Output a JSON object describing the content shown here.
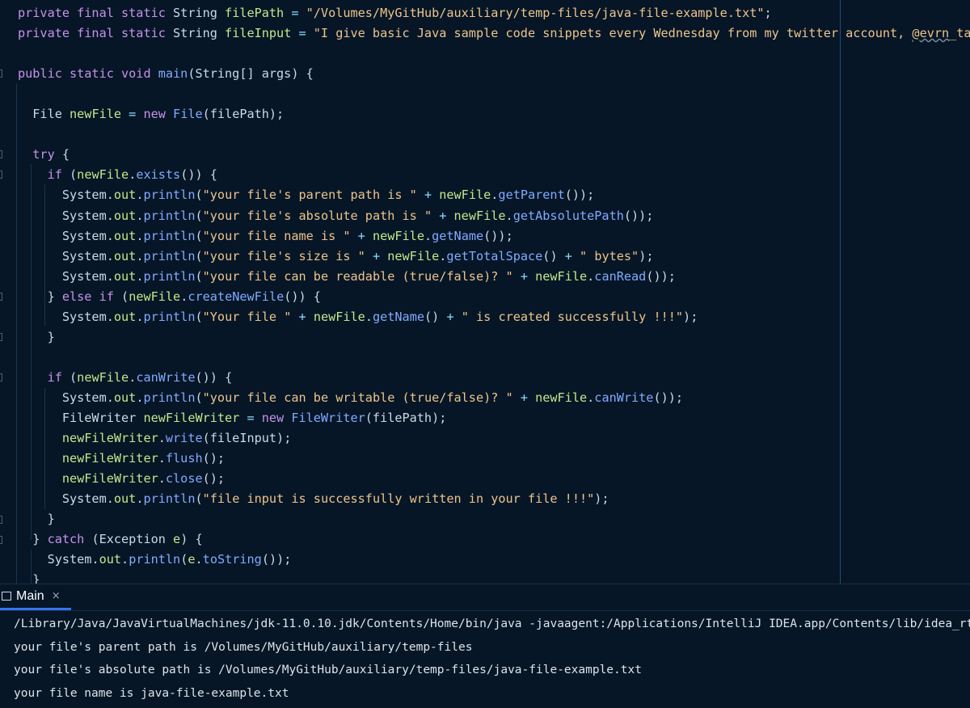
{
  "editor": {
    "lines": [
      [
        {
          "c": "kw",
          "t": "private final static "
        },
        {
          "c": "pl",
          "t": "String "
        },
        {
          "c": "id",
          "t": "filePath"
        },
        {
          "c": "op",
          "t": " = "
        },
        {
          "c": "st",
          "t": "\"/Volumes/MyGitHub/auxiliary/temp-files/java-file-example.txt\""
        },
        {
          "c": "pl",
          "t": ";"
        }
      ],
      [
        {
          "c": "kw",
          "t": "private final static "
        },
        {
          "c": "pl",
          "t": "String "
        },
        {
          "c": "id",
          "t": "fileInput"
        },
        {
          "c": "op",
          "t": " = "
        },
        {
          "c": "st",
          "t": "\"I give basic Java sample code snippets every Wednesday from my twitter account, "
        },
        {
          "c": "st wavy",
          "t": "@evrn"
        },
        {
          "c": "st",
          "t": "_tan !!!\""
        },
        {
          "c": "pl",
          "t": ";"
        }
      ],
      [],
      [
        {
          "c": "kw",
          "t": "public static void "
        },
        {
          "c": "fn",
          "t": "main"
        },
        {
          "c": "pl",
          "t": "(String[] args) {"
        }
      ],
      [],
      [
        {
          "c": "pl",
          "t": "  File "
        },
        {
          "c": "id",
          "t": "newFile"
        },
        {
          "c": "op",
          "t": " = "
        },
        {
          "c": "kw",
          "t": "new "
        },
        {
          "c": "fn",
          "t": "File"
        },
        {
          "c": "pl",
          "t": "(filePath);"
        }
      ],
      [],
      [
        {
          "c": "kw",
          "t": "  try "
        },
        {
          "c": "pl",
          "t": "{"
        }
      ],
      [
        {
          "c": "kw",
          "t": "    if "
        },
        {
          "c": "pl",
          "t": "("
        },
        {
          "c": "id",
          "t": "newFile"
        },
        {
          "c": "pl",
          "t": "."
        },
        {
          "c": "fn",
          "t": "exists"
        },
        {
          "c": "pl",
          "t": "()) {"
        }
      ],
      [
        {
          "c": "pl",
          "t": "      System."
        },
        {
          "c": "id",
          "t": "out"
        },
        {
          "c": "pl",
          "t": "."
        },
        {
          "c": "fn",
          "t": "println"
        },
        {
          "c": "pl",
          "t": "("
        },
        {
          "c": "st",
          "t": "\"your file's parent path is \""
        },
        {
          "c": "op",
          "t": " + "
        },
        {
          "c": "id",
          "t": "newFile"
        },
        {
          "c": "pl",
          "t": "."
        },
        {
          "c": "fn",
          "t": "getParent"
        },
        {
          "c": "pl",
          "t": "());"
        }
      ],
      [
        {
          "c": "pl",
          "t": "      System."
        },
        {
          "c": "id",
          "t": "out"
        },
        {
          "c": "pl",
          "t": "."
        },
        {
          "c": "fn",
          "t": "println"
        },
        {
          "c": "pl",
          "t": "("
        },
        {
          "c": "st",
          "t": "\"your file's absolute path is \""
        },
        {
          "c": "op",
          "t": " + "
        },
        {
          "c": "id",
          "t": "newFile"
        },
        {
          "c": "pl",
          "t": "."
        },
        {
          "c": "fn",
          "t": "getAbsolutePath"
        },
        {
          "c": "pl",
          "t": "());"
        }
      ],
      [
        {
          "c": "pl",
          "t": "      System."
        },
        {
          "c": "id",
          "t": "out"
        },
        {
          "c": "pl",
          "t": "."
        },
        {
          "c": "fn",
          "t": "println"
        },
        {
          "c": "pl",
          "t": "("
        },
        {
          "c": "st",
          "t": "\"your file name is \""
        },
        {
          "c": "op",
          "t": " + "
        },
        {
          "c": "id",
          "t": "newFile"
        },
        {
          "c": "pl",
          "t": "."
        },
        {
          "c": "fn",
          "t": "getName"
        },
        {
          "c": "pl",
          "t": "());"
        }
      ],
      [
        {
          "c": "pl",
          "t": "      System."
        },
        {
          "c": "id",
          "t": "out"
        },
        {
          "c": "pl",
          "t": "."
        },
        {
          "c": "fn",
          "t": "println"
        },
        {
          "c": "pl",
          "t": "("
        },
        {
          "c": "st",
          "t": "\"your file's size is \""
        },
        {
          "c": "op",
          "t": " + "
        },
        {
          "c": "id",
          "t": "newFile"
        },
        {
          "c": "pl",
          "t": "."
        },
        {
          "c": "fn",
          "t": "getTotalSpace"
        },
        {
          "c": "pl",
          "t": "()"
        },
        {
          "c": "op",
          "t": " + "
        },
        {
          "c": "st",
          "t": "\" bytes\""
        },
        {
          "c": "pl",
          "t": ");"
        }
      ],
      [
        {
          "c": "pl",
          "t": "      System."
        },
        {
          "c": "id",
          "t": "out"
        },
        {
          "c": "pl",
          "t": "."
        },
        {
          "c": "fn",
          "t": "println"
        },
        {
          "c": "pl",
          "t": "("
        },
        {
          "c": "st",
          "t": "\"your file can be readable (true/false)? \""
        },
        {
          "c": "op",
          "t": " + "
        },
        {
          "c": "id",
          "t": "newFile"
        },
        {
          "c": "pl",
          "t": "."
        },
        {
          "c": "fn",
          "t": "canRead"
        },
        {
          "c": "pl",
          "t": "());"
        }
      ],
      [
        {
          "c": "pl",
          "t": "    } "
        },
        {
          "c": "kw",
          "t": "else if "
        },
        {
          "c": "pl",
          "t": "("
        },
        {
          "c": "id",
          "t": "newFile"
        },
        {
          "c": "pl",
          "t": "."
        },
        {
          "c": "fn",
          "t": "createNewFile"
        },
        {
          "c": "pl",
          "t": "()) {"
        }
      ],
      [
        {
          "c": "pl",
          "t": "      System."
        },
        {
          "c": "id",
          "t": "out"
        },
        {
          "c": "pl",
          "t": "."
        },
        {
          "c": "fn",
          "t": "println"
        },
        {
          "c": "pl",
          "t": "("
        },
        {
          "c": "st",
          "t": "\"Your file \""
        },
        {
          "c": "op",
          "t": " + "
        },
        {
          "c": "id",
          "t": "newFile"
        },
        {
          "c": "pl",
          "t": "."
        },
        {
          "c": "fn",
          "t": "getName"
        },
        {
          "c": "pl",
          "t": "()"
        },
        {
          "c": "op",
          "t": " + "
        },
        {
          "c": "st",
          "t": "\" is created successfully !!!\""
        },
        {
          "c": "pl",
          "t": ");"
        }
      ],
      [
        {
          "c": "pl",
          "t": "    }"
        }
      ],
      [],
      [
        {
          "c": "kw",
          "t": "    if "
        },
        {
          "c": "pl",
          "t": "("
        },
        {
          "c": "id",
          "t": "newFile"
        },
        {
          "c": "pl",
          "t": "."
        },
        {
          "c": "fn",
          "t": "canWrite"
        },
        {
          "c": "pl",
          "t": "()) {"
        }
      ],
      [
        {
          "c": "pl",
          "t": "      System."
        },
        {
          "c": "id",
          "t": "out"
        },
        {
          "c": "pl",
          "t": "."
        },
        {
          "c": "fn",
          "t": "println"
        },
        {
          "c": "pl",
          "t": "("
        },
        {
          "c": "st",
          "t": "\"your file can be writable (true/false)? \""
        },
        {
          "c": "op",
          "t": " + "
        },
        {
          "c": "id",
          "t": "newFile"
        },
        {
          "c": "pl",
          "t": "."
        },
        {
          "c": "fn",
          "t": "canWrite"
        },
        {
          "c": "pl",
          "t": "());"
        }
      ],
      [
        {
          "c": "pl",
          "t": "      FileWriter "
        },
        {
          "c": "id",
          "t": "newFileWriter"
        },
        {
          "c": "op",
          "t": " = "
        },
        {
          "c": "kw",
          "t": "new "
        },
        {
          "c": "fn",
          "t": "FileWriter"
        },
        {
          "c": "pl",
          "t": "(filePath);"
        }
      ],
      [
        {
          "c": "id",
          "t": "      newFileWriter"
        },
        {
          "c": "pl",
          "t": "."
        },
        {
          "c": "fn",
          "t": "write"
        },
        {
          "c": "pl",
          "t": "(fileInput);"
        }
      ],
      [
        {
          "c": "id",
          "t": "      newFileWriter"
        },
        {
          "c": "pl",
          "t": "."
        },
        {
          "c": "fn",
          "t": "flush"
        },
        {
          "c": "pl",
          "t": "();"
        }
      ],
      [
        {
          "c": "id",
          "t": "      newFileWriter"
        },
        {
          "c": "pl",
          "t": "."
        },
        {
          "c": "fn",
          "t": "close"
        },
        {
          "c": "pl",
          "t": "();"
        }
      ],
      [
        {
          "c": "pl",
          "t": "      System."
        },
        {
          "c": "id",
          "t": "out"
        },
        {
          "c": "pl",
          "t": "."
        },
        {
          "c": "fn",
          "t": "println"
        },
        {
          "c": "pl",
          "t": "("
        },
        {
          "c": "st",
          "t": "\"file input is successfully written in your file !!!\""
        },
        {
          "c": "pl",
          "t": ");"
        }
      ],
      [
        {
          "c": "pl",
          "t": "    }"
        }
      ],
      [
        {
          "c": "pl",
          "t": "  } "
        },
        {
          "c": "kw",
          "t": "catch "
        },
        {
          "c": "pl",
          "t": "(Exception "
        },
        {
          "c": "id",
          "t": "e"
        },
        {
          "c": "pl",
          "t": ") {"
        }
      ],
      [
        {
          "c": "pl",
          "t": "    System."
        },
        {
          "c": "id",
          "t": "out"
        },
        {
          "c": "pl",
          "t": "."
        },
        {
          "c": "fn",
          "t": "println"
        },
        {
          "c": "pl",
          "t": "("
        },
        {
          "c": "id",
          "t": "e"
        },
        {
          "c": "pl",
          "t": "."
        },
        {
          "c": "fn",
          "t": "toString"
        },
        {
          "c": "pl",
          "t": "());"
        }
      ],
      [
        {
          "c": "pl",
          "t": "  }"
        }
      ]
    ]
  },
  "run_panel": {
    "tab_label": "Main",
    "tab_close": "×",
    "output": [
      "/Library/Java/JavaVirtualMachines/jdk-11.0.10.jdk/Contents/Home/bin/java -javaagent:/Applications/IntelliJ IDEA.app/Contents/lib/idea_rt.jar",
      "your file's parent path is /Volumes/MyGitHub/auxiliary/temp-files",
      "your file's absolute path is /Volumes/MyGitHub/auxiliary/temp-files/java-file-example.txt",
      "your file name is java-file-example.txt"
    ]
  }
}
